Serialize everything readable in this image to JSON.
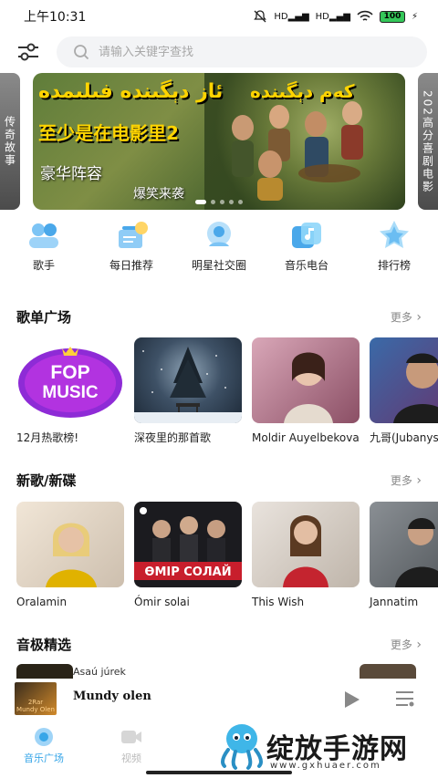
{
  "status_bar": {
    "time": "上午10:31",
    "network_1": "HD",
    "network_2": "HD",
    "battery": "100"
  },
  "search": {
    "placeholder": "请输入关键字查找"
  },
  "banner": {
    "left_card": "传奇故事",
    "right_card": "202高分喜剧电影",
    "headline_ug_1": "ﺋﺎﺯ ﺩﯦﮕﯩﻨﺪە ﻓﯩﻠﯩﻤﺪە",
    "headline_ug_2": "ﻛﻪﻡ ﺩﯦﮕﯩﻨﺪە",
    "headline_cn": "至少是在电影里",
    "subtitle_1": "豪华阵容",
    "subtitle_2": "爆笑来袭",
    "number": "2"
  },
  "categories": [
    {
      "label": "歌手",
      "icon": "singer-icon"
    },
    {
      "label": "每日推荐",
      "icon": "daily-recommend-icon"
    },
    {
      "label": "明星社交圈",
      "icon": "star-social-icon"
    },
    {
      "label": "音乐电台",
      "icon": "radio-icon"
    },
    {
      "label": "排行榜",
      "icon": "ranking-icon"
    }
  ],
  "sections": {
    "playlists": {
      "title": "歌单广场",
      "more": "更多",
      "items": [
        {
          "title": "12月热歌榜!",
          "cover_text": "FOP MUSIC"
        },
        {
          "title": "深夜里的那首歌"
        },
        {
          "title": "Moldir Auyelbekova"
        },
        {
          "title": "九哥(Jubanysh)"
        }
      ]
    },
    "new_songs": {
      "title": "新歌/新碟",
      "more": "更多",
      "items": [
        {
          "title": "Oralamin"
        },
        {
          "title": "Ómir solai",
          "cover_text": "ӨМІР СОЛАЙ"
        },
        {
          "title": "This Wish"
        },
        {
          "title": "Jannatim"
        }
      ]
    },
    "hifi": {
      "title": "音极精选",
      "more": "更多",
      "partial_item": "Asaú júrek"
    }
  },
  "player": {
    "song": "Mundy olen",
    "cover_text_1": "2Rar",
    "cover_text_2": "Mundy Olen"
  },
  "tabs": [
    {
      "label": "音乐广场",
      "active": true
    },
    {
      "label": "视频",
      "active": false
    }
  ],
  "watermark": {
    "text": "绽放手游网",
    "url": "www.gxhuaer.com"
  },
  "colors": {
    "accent": "#38a6e8",
    "banner_yellow": "#ffd400",
    "fop_purple": "#8e2bd6"
  }
}
